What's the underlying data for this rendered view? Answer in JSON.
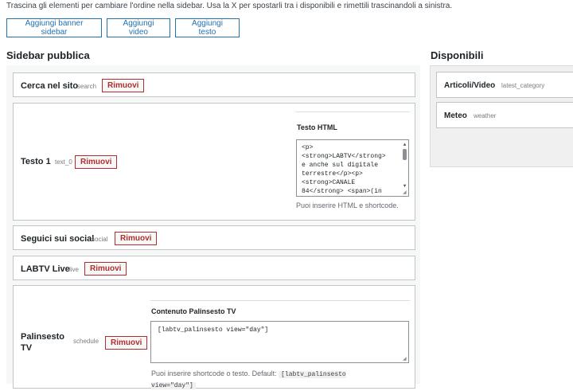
{
  "intro_text": "Trascina gli elementi per cambiare l'ordine nella sidebar. Usa la X per spostarli tra i disponibili e rimettili trascinandoli a sinistra.",
  "toolbar": {
    "add_banner": "Aggiungi banner sidebar",
    "add_video": "Aggiungi video",
    "add_text": "Aggiungi testo"
  },
  "sections": {
    "public_title": "Sidebar pubblica",
    "available_title": "Disponibili"
  },
  "remove_label": "Rimuovi",
  "public_widgets": [
    {
      "name": "Cerca nel sito",
      "id": "search"
    },
    {
      "name": "Testo 1",
      "id": "text_0",
      "field_label": "Testo HTML",
      "field_value": "<p>\n<strong>LABTV</strong>\ne anche sul digitale\nterrestre</p><p>\n<strong>CANALE\n84</strong> <span>(in",
      "help": "Puoi inserire HTML e shortcode."
    },
    {
      "name": "Seguici sui social",
      "id": "social"
    },
    {
      "name": "LABTV Live",
      "id": "live"
    },
    {
      "name": "Palinsesto TV",
      "id": "schedule",
      "field_label": "Contenuto Palinsesto TV",
      "field_value": "[labtv_palinsesto view=\"day\"]",
      "help_prefix": "Puoi inserire shortcode o testo. Default:",
      "help_code": "[labtv_palinsesto view=\"day\"]"
    }
  ],
  "available_widgets": [
    {
      "name": "Articoli/Video",
      "id": "latest_category"
    },
    {
      "name": "Meteo",
      "id": "weather"
    }
  ],
  "colors": {
    "accent": "#2271b1",
    "danger": "#b32d2e"
  }
}
